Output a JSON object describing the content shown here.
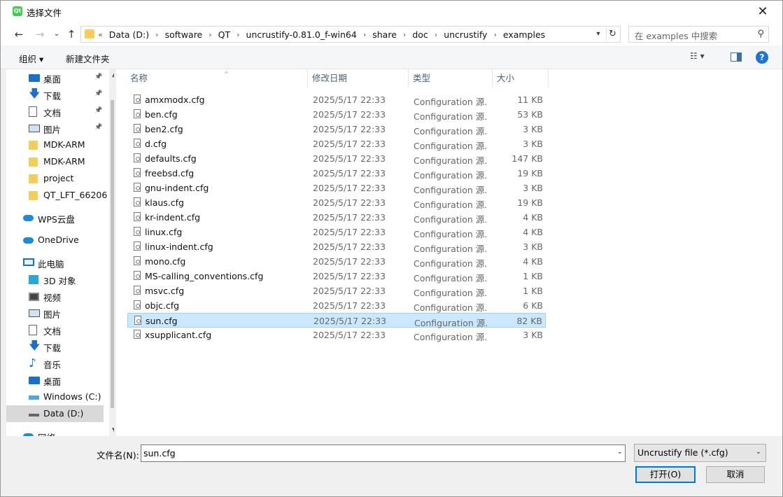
{
  "window": {
    "title": "选择文件",
    "app_icon_text": "Qt"
  },
  "nav": {
    "crumb_overflow": "«",
    "breadcrumbs": [
      "Data (D:)",
      "software",
      "QT",
      "uncrustify-0.81.0_f-win64",
      "share",
      "doc",
      "uncrustify",
      "examples"
    ],
    "search_placeholder": "在 examples 中搜索"
  },
  "toolbar": {
    "organize_label": "组织 ▾",
    "new_folder_label": "新建文件夹"
  },
  "sidebar": {
    "items": [
      {
        "label": "桌面",
        "icon": "desktop-icon",
        "pinned": true
      },
      {
        "label": "下载",
        "icon": "download-icon",
        "pinned": true
      },
      {
        "label": "文档",
        "icon": "document-icon",
        "pinned": true
      },
      {
        "label": "图片",
        "icon": "pictures-icon",
        "pinned": true
      },
      {
        "label": "MDK-ARM",
        "icon": "folder-icon",
        "pinned": false
      },
      {
        "label": "MDK-ARM",
        "icon": "folder-icon",
        "pinned": false
      },
      {
        "label": "project",
        "icon": "folder-icon",
        "pinned": false
      },
      {
        "label": "QT_LFT_66206",
        "icon": "folder-icon",
        "pinned": false
      },
      {
        "label": "WPS云盘",
        "icon": "cloud-icon",
        "pinned": false
      },
      {
        "label": "OneDrive",
        "icon": "cloud-icon",
        "pinned": false
      },
      {
        "label": "此电脑",
        "icon": "computer-icon",
        "pinned": false
      },
      {
        "label": "3D 对象",
        "icon": "3d-objects-icon",
        "pinned": false
      },
      {
        "label": "视频",
        "icon": "video-icon",
        "pinned": false
      },
      {
        "label": "图片",
        "icon": "pictures-icon",
        "pinned": false
      },
      {
        "label": "文档",
        "icon": "document-icon",
        "pinned": false
      },
      {
        "label": "下载",
        "icon": "download-icon",
        "pinned": false
      },
      {
        "label": "音乐",
        "icon": "music-icon",
        "pinned": false
      },
      {
        "label": "桌面",
        "icon": "desktop-icon",
        "pinned": false
      },
      {
        "label": "Windows (C:)",
        "icon": "windows-drive-icon",
        "pinned": false
      },
      {
        "label": "Data (D:)",
        "icon": "drive-icon",
        "pinned": false,
        "selected": true
      },
      {
        "label": "网络",
        "icon": "network-icon",
        "pinned": false
      }
    ]
  },
  "filelist": {
    "columns": {
      "name": "名称",
      "date": "修改日期",
      "type": "类型",
      "size": "大小"
    },
    "files": [
      {
        "name": "amxmodx.cfg",
        "date": "2025/5/17 22:33",
        "type": "Configuration 源...",
        "size": "11 KB"
      },
      {
        "name": "ben.cfg",
        "date": "2025/5/17 22:33",
        "type": "Configuration 源...",
        "size": "53 KB"
      },
      {
        "name": "ben2.cfg",
        "date": "2025/5/17 22:33",
        "type": "Configuration 源...",
        "size": "3 KB"
      },
      {
        "name": "d.cfg",
        "date": "2025/5/17 22:33",
        "type": "Configuration 源...",
        "size": "3 KB"
      },
      {
        "name": "defaults.cfg",
        "date": "2025/5/17 22:33",
        "type": "Configuration 源...",
        "size": "147 KB"
      },
      {
        "name": "freebsd.cfg",
        "date": "2025/5/17 22:33",
        "type": "Configuration 源...",
        "size": "19 KB"
      },
      {
        "name": "gnu-indent.cfg",
        "date": "2025/5/17 22:33",
        "type": "Configuration 源...",
        "size": "3 KB"
      },
      {
        "name": "klaus.cfg",
        "date": "2025/5/17 22:33",
        "type": "Configuration 源...",
        "size": "19 KB"
      },
      {
        "name": "kr-indent.cfg",
        "date": "2025/5/17 22:33",
        "type": "Configuration 源...",
        "size": "4 KB"
      },
      {
        "name": "linux.cfg",
        "date": "2025/5/17 22:33",
        "type": "Configuration 源...",
        "size": "4 KB"
      },
      {
        "name": "linux-indent.cfg",
        "date": "2025/5/17 22:33",
        "type": "Configuration 源...",
        "size": "3 KB"
      },
      {
        "name": "mono.cfg",
        "date": "2025/5/17 22:33",
        "type": "Configuration 源...",
        "size": "4 KB"
      },
      {
        "name": "MS-calling_conventions.cfg",
        "date": "2025/5/17 22:33",
        "type": "Configuration 源...",
        "size": "1 KB"
      },
      {
        "name": "msvc.cfg",
        "date": "2025/5/17 22:33",
        "type": "Configuration 源...",
        "size": "1 KB"
      },
      {
        "name": "objc.cfg",
        "date": "2025/5/17 22:33",
        "type": "Configuration 源...",
        "size": "6 KB"
      },
      {
        "name": "sun.cfg",
        "date": "2025/5/17 22:33",
        "type": "Configuration 源...",
        "size": "82 KB",
        "selected": true
      },
      {
        "name": "xsupplicant.cfg",
        "date": "2025/5/17 22:33",
        "type": "Configuration 源...",
        "size": "3 KB"
      }
    ]
  },
  "footer": {
    "filename_label": "文件名(N):",
    "filename_value": "sun.cfg",
    "filter_value": "Uncrustify file (*.cfg)",
    "open_label": "打开(O)",
    "cancel_label": "取消"
  }
}
